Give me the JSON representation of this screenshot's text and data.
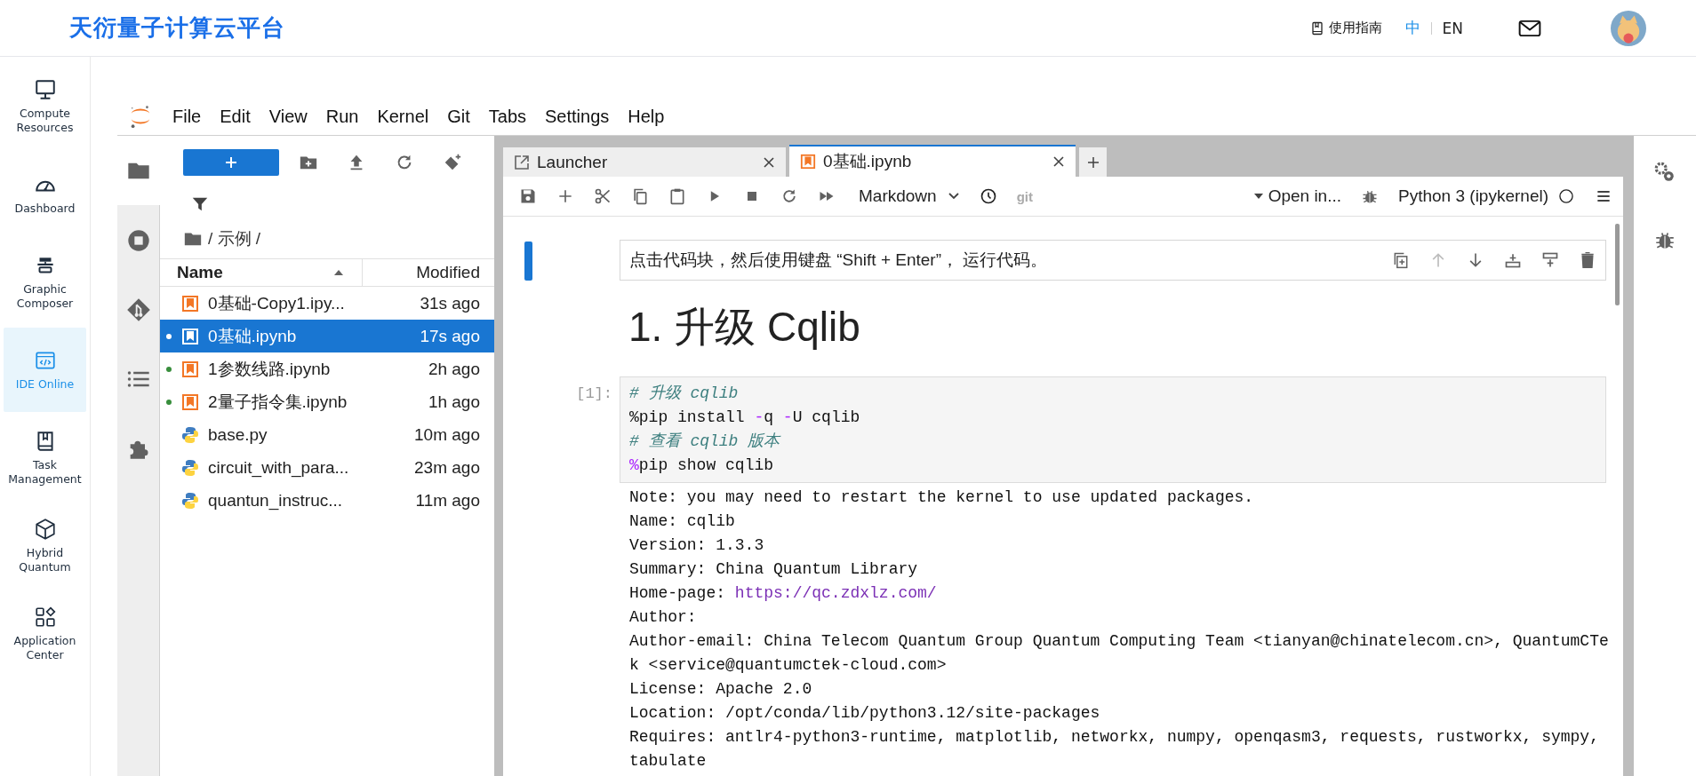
{
  "header": {
    "logo": "天衍量子计算云平台",
    "guide": "使用指南",
    "languages": [
      {
        "label": "中",
        "selected": true
      },
      {
        "label": "EN",
        "selected": false
      }
    ]
  },
  "nav": [
    {
      "label": "Compute Resources",
      "kind": "monitor",
      "selected": false
    },
    {
      "label": "Dashboard",
      "kind": "gauge",
      "selected": false
    },
    {
      "label": "Graphic Composer",
      "kind": "composer",
      "selected": false
    },
    {
      "label": "IDE Online",
      "kind": "code-window",
      "selected": true
    },
    {
      "label": "Task Management",
      "kind": "book",
      "selected": false
    },
    {
      "label": "Hybrid Quantum",
      "kind": "cube",
      "selected": false
    },
    {
      "label": "Application Center",
      "kind": "apps",
      "selected": false
    }
  ],
  "menu": [
    "File",
    "Edit",
    "View",
    "Run",
    "Kernel",
    "Git",
    "Tabs",
    "Settings",
    "Help"
  ],
  "file_browser": {
    "path": "/ 示例 /",
    "columns": [
      {
        "label": "Name",
        "sorted": true
      },
      {
        "label": "Modified",
        "sorted": false
      }
    ],
    "files": [
      {
        "name": "0基础-Copy1.ipy...",
        "modified": "31s ago",
        "kind": "notebook",
        "selected": false,
        "running": false
      },
      {
        "name": "0基础.ipynb",
        "modified": "17s ago",
        "kind": "notebook",
        "selected": true,
        "running": true
      },
      {
        "name": "1参数线路.ipynb",
        "modified": "2h ago",
        "kind": "notebook",
        "selected": false,
        "running": true
      },
      {
        "name": "2量子指令集.ipynb",
        "modified": "1h ago",
        "kind": "notebook",
        "selected": false,
        "running": true
      },
      {
        "name": "base.py",
        "modified": "10m ago",
        "kind": "python",
        "selected": false,
        "running": false
      },
      {
        "name": "circuit_with_para...",
        "modified": "23m ago",
        "kind": "python",
        "selected": false,
        "running": false
      },
      {
        "name": "quantun_instruc...",
        "modified": "11m ago",
        "kind": "python",
        "selected": false,
        "running": false
      }
    ]
  },
  "tabs": [
    {
      "label": "Launcher",
      "kind": "launcher",
      "selected": false
    },
    {
      "label": "0基础.ipynb",
      "kind": "notebook",
      "selected": true
    }
  ],
  "notebook_toolbar": {
    "cell_type": "Markdown",
    "git": "git",
    "open_in": "Open in...",
    "kernel": "Python 3 (ipykernel)"
  },
  "cells": [
    {
      "kind": "markdown-edit",
      "selected": true,
      "text": "点击代码块，然后使用键盘 “Shift + Enter”， 运行代码。"
    },
    {
      "kind": "heading",
      "selected": false,
      "text": "1. 升级 Cqlib"
    },
    {
      "kind": "code",
      "selected": false,
      "prompt": "[1]:",
      "lines": [
        [
          {
            "text": "# 升级 cqlib",
            "kind": "comment"
          }
        ],
        [
          {
            "text": "%pip install ",
            "kind": "plain"
          },
          {
            "text": "-",
            "kind": "operator"
          },
          {
            "text": "q ",
            "kind": "plain"
          },
          {
            "text": "-",
            "kind": "operator"
          },
          {
            "text": "U cqlib",
            "kind": "plain"
          }
        ],
        [
          {
            "text": "# 查看 cqlib 版本",
            "kind": "comment"
          }
        ],
        [
          {
            "text": "%",
            "kind": "operator"
          },
          {
            "text": "pip show cqlib",
            "kind": "plain"
          }
        ]
      ],
      "output": [
        [
          {
            "text": "Note: you may need to restart the kernel to use updated packages.",
            "kind": "plain"
          }
        ],
        [
          {
            "text": "Name: cqlib",
            "kind": "plain"
          }
        ],
        [
          {
            "text": "Version: 1.3.3",
            "kind": "plain"
          }
        ],
        [
          {
            "text": "Summary: China Quantum Library",
            "kind": "plain"
          }
        ],
        [
          {
            "text": "Home-page: ",
            "kind": "plain"
          },
          {
            "text": "https://qc.zdxlz.com/",
            "kind": "link"
          }
        ],
        [
          {
            "text": "Author:",
            "kind": "plain"
          }
        ],
        [
          {
            "text": "Author-email: China Telecom Quantum Group Quantum Computing Team <tianyan@chinatelecom.cn>, QuantumCTek <service@quantumctek-cloud.com>",
            "kind": "plain"
          }
        ],
        [
          {
            "text": "License: Apache 2.0",
            "kind": "plain"
          }
        ],
        [
          {
            "text": "Location: /opt/conda/lib/python3.12/site-packages",
            "kind": "plain"
          }
        ],
        [
          {
            "text": "Requires: antlr4-python3-runtime, matplotlib, networkx, numpy, openqasm3, requests, rustworkx, sympy, tabulate",
            "kind": "plain"
          }
        ]
      ]
    }
  ]
}
